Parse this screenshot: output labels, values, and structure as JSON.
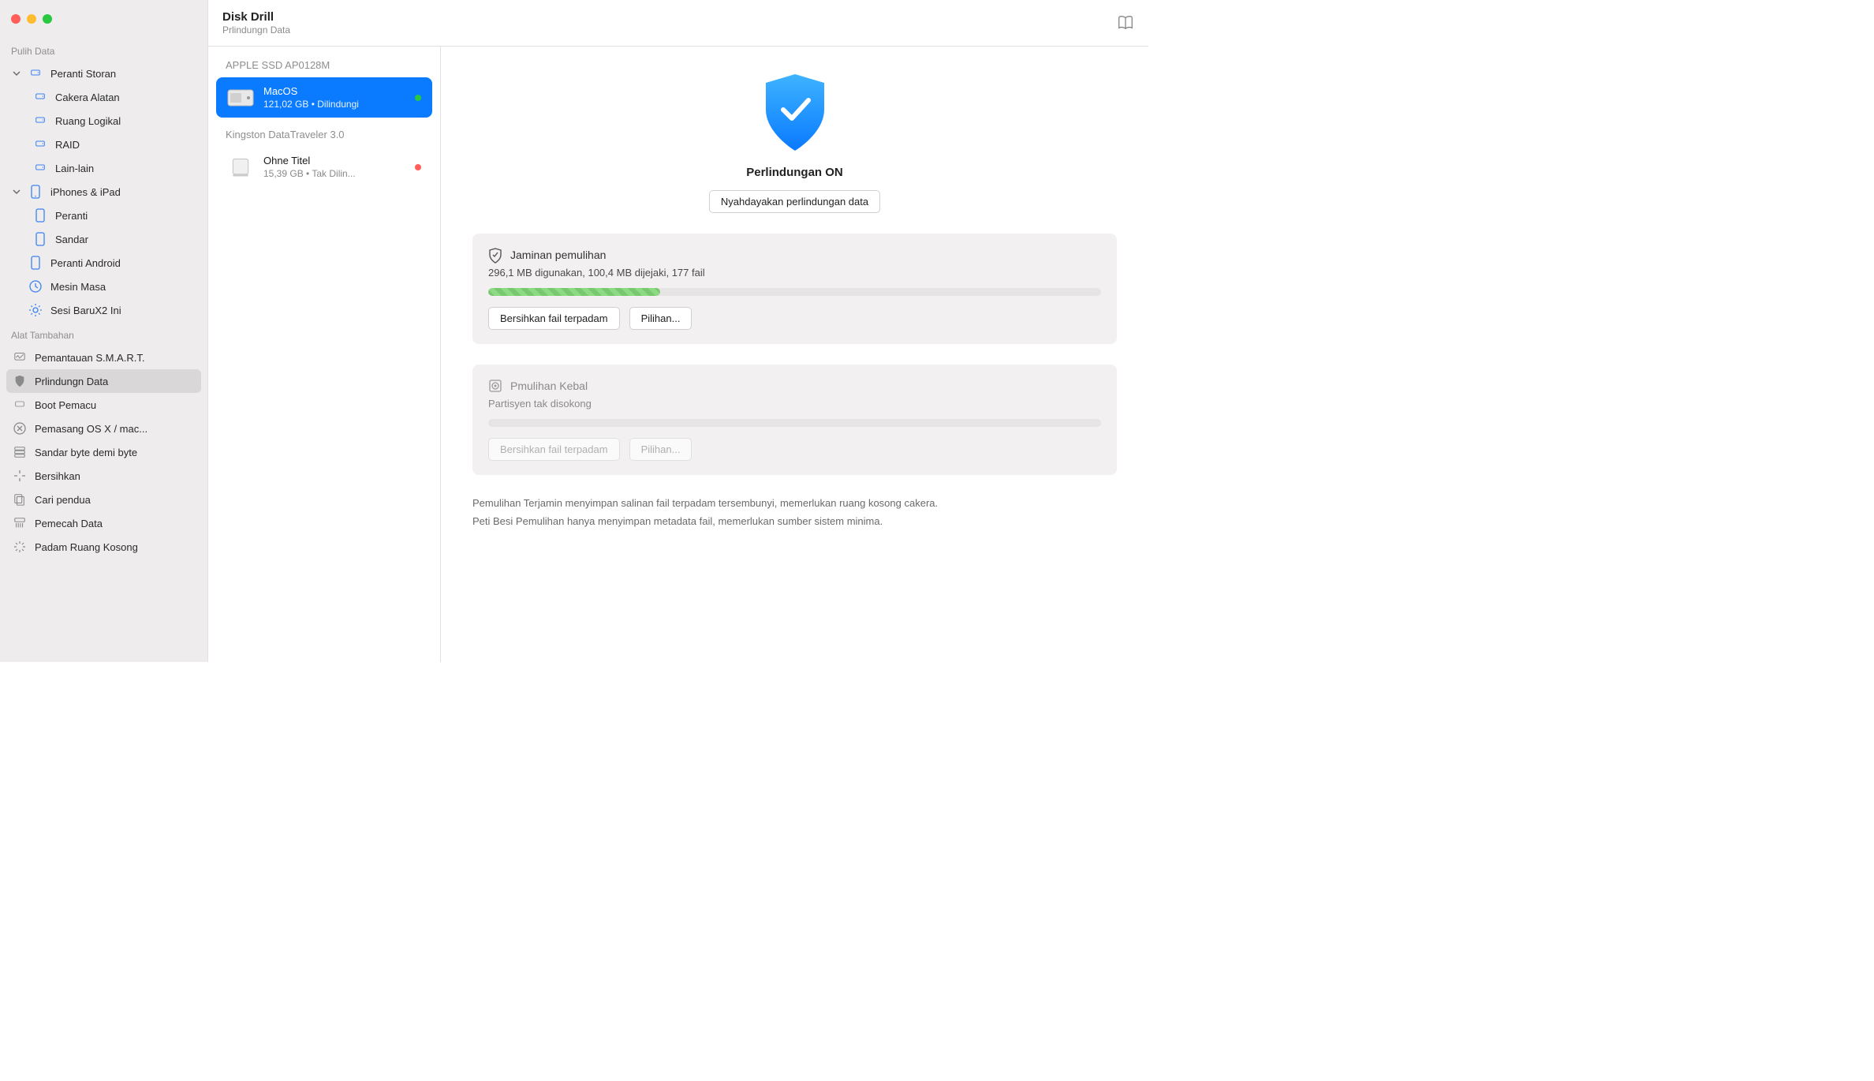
{
  "app": {
    "title": "Disk Drill",
    "subtitle": "Prlindungn Data"
  },
  "sidebar": {
    "recover_title": "Pulih Data",
    "storage_devices": "Peranti Storan",
    "disk_utility": "Cakera Alatan",
    "logical_volume": "Ruang Logikal",
    "raid": "RAID",
    "other": "Lain-lain",
    "iphones": "iPhones & iPad",
    "device": "Peranti",
    "dock": "Sandar",
    "android": "Peranti Android",
    "time_machine": "Mesin Masa",
    "sessions": "Sesi BaruX2 Ini",
    "extras_title": "Alat Tambahan",
    "smart": "Pemantauan S.M.A.R.T.",
    "data_protection": "Prlindungn Data",
    "boot_drive": "Boot Pemacu",
    "osx_installer": "Pemasang OS X / mac...",
    "byte_backup": "Sandar byte demi byte",
    "clean": "Bersihkan",
    "find_dupes": "Cari pendua",
    "data_shredder": "Pemecah Data",
    "erase_free": "Padam Ruang Kosong"
  },
  "mid": {
    "disk1_name": "APPLE SSD AP0128M",
    "vol1_name": "MacOS",
    "vol1_sub": "121,02 GB • Dilindungi",
    "disk2_name": "Kingston DataTraveler 3.0",
    "vol2_name": "Ohne Titel",
    "vol2_sub": "15,39 GB • Tak Dilin..."
  },
  "main": {
    "status": "Perlindungan ON",
    "disable_btn": "Nyahdayakan perlindungan data",
    "card1_title": "Jaminan pemulihan",
    "card1_sub": "296,1 MB digunakan, 100,4 MB dijejaki, 177 fail",
    "card1_clean": "Bersihkan fail terpadam",
    "card1_opts": "Pilihan...",
    "card2_title": "Pmulihan Kebal",
    "card2_sub": "Partisyen tak disokong",
    "card2_clean": "Bersihkan fail terpadam",
    "card2_opts": "Pilihan...",
    "note1": "Pemulihan Terjamin menyimpan salinan fail terpadam tersembunyi, memerlukan ruang kosong cakera.",
    "note2": "Peti Besi Pemulihan hanya menyimpan metadata fail, memerlukan sumber sistem minima.",
    "progress_pct": 28
  }
}
